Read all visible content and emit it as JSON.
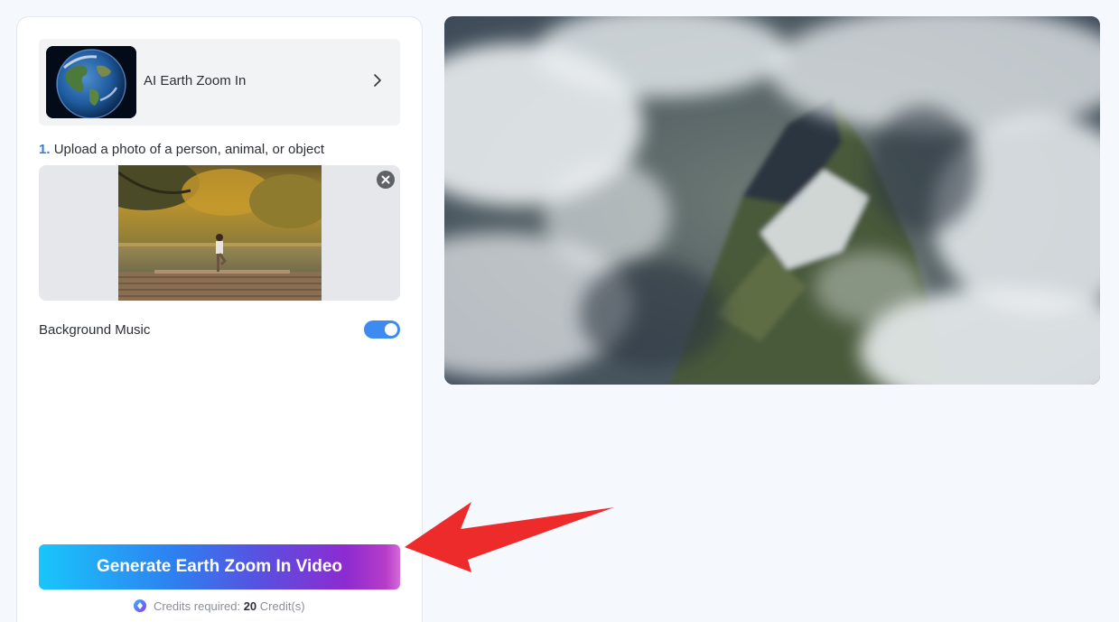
{
  "template": {
    "name": "AI Earth Zoom In",
    "thumb_icon": "earth-globe-image",
    "chevron_icon": "chevron-right-icon"
  },
  "upload": {
    "step_number": "1.",
    "step_text": "Upload a photo of a person, animal, or object",
    "remove_icon": "close-icon"
  },
  "music": {
    "label": "Background Music",
    "enabled": true
  },
  "generate": {
    "label": "Generate Earth Zoom In Video"
  },
  "credits": {
    "prefix": "Credits required:",
    "amount": "20",
    "suffix": "Credit(s)",
    "icon": "credit-diamond-icon"
  },
  "colors": {
    "accent": "#3d8bf0",
    "button_gradient_start": "#19c6fb",
    "button_gradient_end": "#d56ad9",
    "annotation_arrow": "#ee2b2b"
  }
}
